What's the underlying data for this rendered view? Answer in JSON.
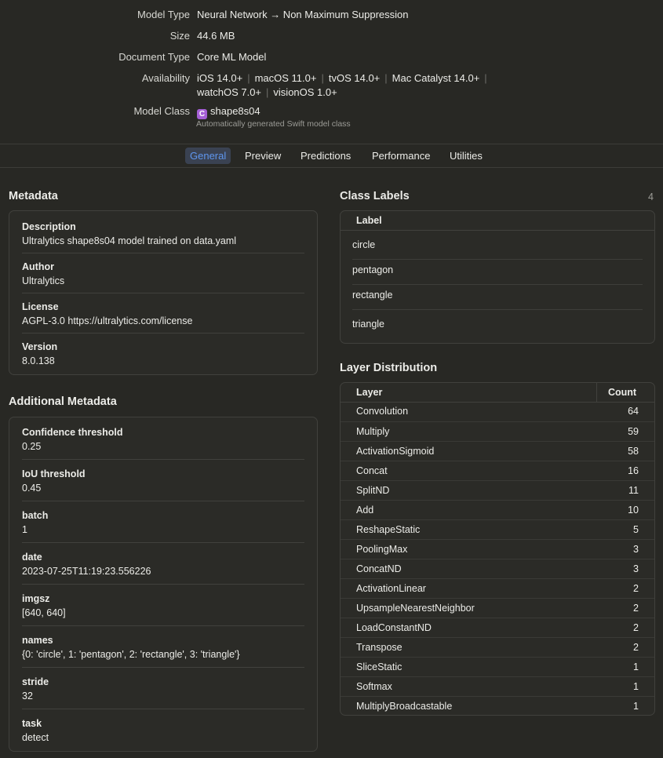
{
  "header": {
    "model_type_label": "Model Type",
    "model_type_value": "Neural Network → Non Maximum Suppression",
    "size_label": "Size",
    "size_value": "44.6 MB",
    "doc_type_label": "Document Type",
    "doc_type_value": "Core ML Model",
    "availability_label": "Availability",
    "availability_line1": [
      "iOS 14.0+",
      "macOS 11.0+",
      "tvOS 14.0+",
      "Mac Catalyst 14.0+"
    ],
    "availability_line2": [
      "watchOS 7.0+",
      "visionOS 1.0+"
    ],
    "model_class_label": "Model Class",
    "model_class_badge": "C",
    "model_class_value": "shape8s04",
    "model_class_sub": "Automatically generated Swift model class"
  },
  "tabs": [
    {
      "label": "General",
      "active": true
    },
    {
      "label": "Preview",
      "active": false
    },
    {
      "label": "Predictions",
      "active": false
    },
    {
      "label": "Performance",
      "active": false
    },
    {
      "label": "Utilities",
      "active": false
    }
  ],
  "metadata": {
    "title": "Metadata",
    "items": [
      {
        "key": "Description",
        "value": "Ultralytics shape8s04 model trained on data.yaml"
      },
      {
        "key": "Author",
        "value": "Ultralytics"
      },
      {
        "key": "License",
        "value": "AGPL-3.0 https://ultralytics.com/license"
      },
      {
        "key": "Version",
        "value": "8.0.138"
      }
    ]
  },
  "additional_metadata": {
    "title": "Additional Metadata",
    "items": [
      {
        "key": "Confidence threshold",
        "value": "0.25"
      },
      {
        "key": "IoU threshold",
        "value": "0.45"
      },
      {
        "key": "batch",
        "value": "1"
      },
      {
        "key": "date",
        "value": "2023-07-25T11:19:23.556226"
      },
      {
        "key": "imgsz",
        "value": "[640, 640]"
      },
      {
        "key": "names",
        "value": "{0: 'circle', 1: 'pentagon', 2: 'rectangle', 3: 'triangle'}"
      },
      {
        "key": "stride",
        "value": "32"
      },
      {
        "key": "task",
        "value": "detect"
      }
    ]
  },
  "class_labels": {
    "title": "Class Labels",
    "count": "4",
    "header": "Label",
    "labels": [
      "circle",
      "pentagon",
      "rectangle",
      "triangle"
    ]
  },
  "layer_distribution": {
    "title": "Layer Distribution",
    "col_layer": "Layer",
    "col_count": "Count",
    "rows": [
      {
        "layer": "Convolution",
        "count": "64"
      },
      {
        "layer": "Multiply",
        "count": "59"
      },
      {
        "layer": "ActivationSigmoid",
        "count": "58"
      },
      {
        "layer": "Concat",
        "count": "16"
      },
      {
        "layer": "SplitND",
        "count": "11"
      },
      {
        "layer": "Add",
        "count": "10"
      },
      {
        "layer": "ReshapeStatic",
        "count": "5"
      },
      {
        "layer": "PoolingMax",
        "count": "3"
      },
      {
        "layer": "ConcatND",
        "count": "3"
      },
      {
        "layer": "ActivationLinear",
        "count": "2"
      },
      {
        "layer": "UpsampleNearestNeighbor",
        "count": "2"
      },
      {
        "layer": "LoadConstantND",
        "count": "2"
      },
      {
        "layer": "Transpose",
        "count": "2"
      },
      {
        "layer": "SliceStatic",
        "count": "1"
      },
      {
        "layer": "Softmax",
        "count": "1"
      },
      {
        "layer": "MultiplyBroadcastable",
        "count": "1"
      }
    ]
  }
}
